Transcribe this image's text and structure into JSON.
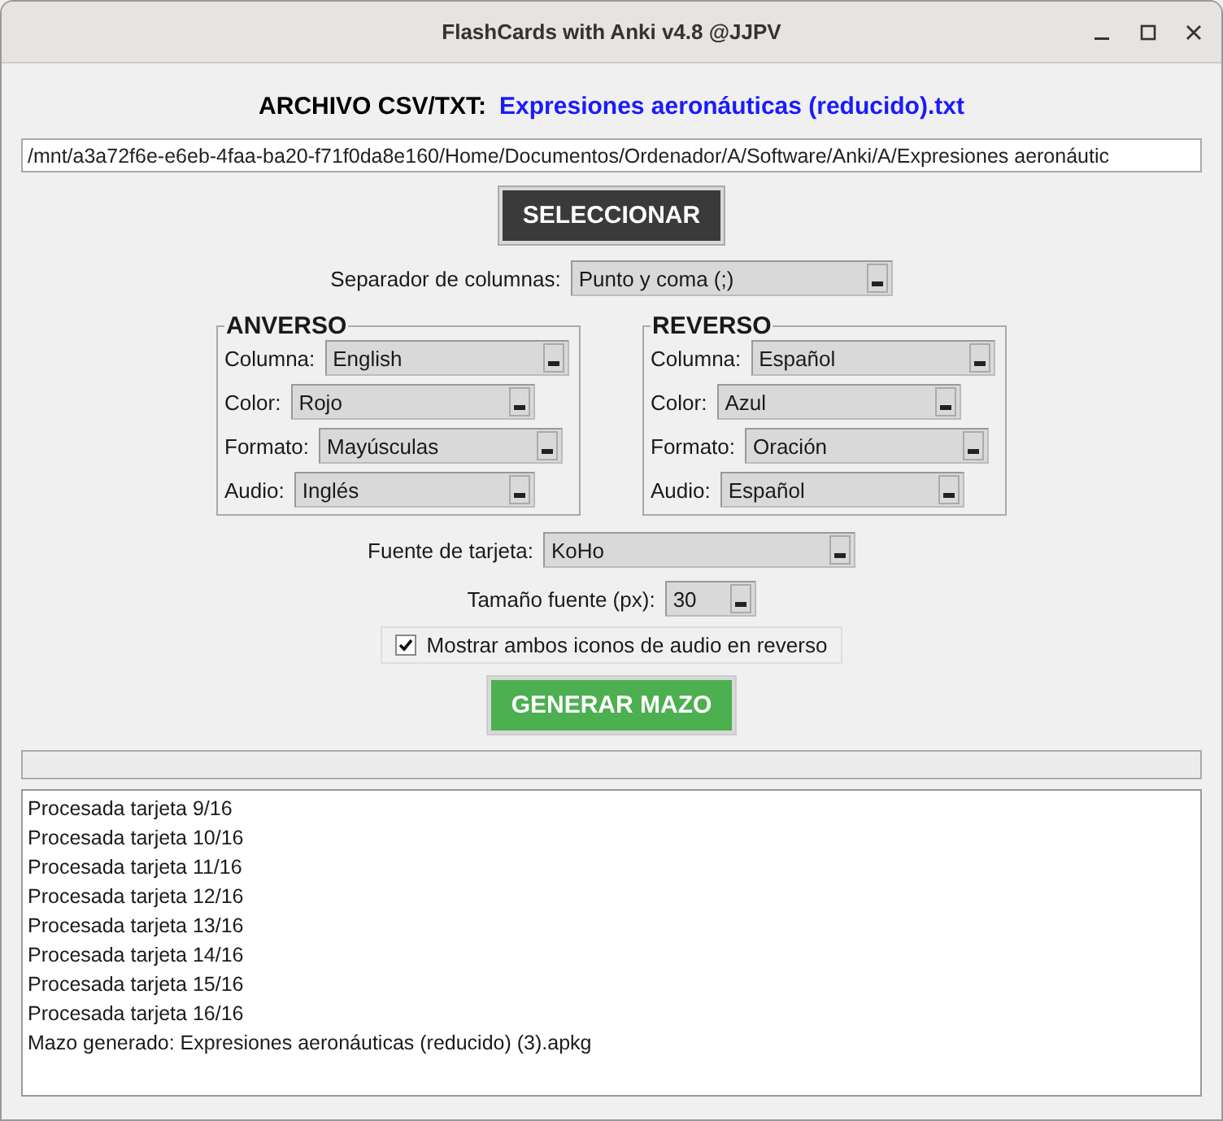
{
  "window": {
    "title": "FlashCards with Anki v4.8 @JJPV"
  },
  "file": {
    "label": "ARCHIVO CSV/TXT:",
    "name": "Expresiones aeronáuticas (reducido).txt",
    "path": "/mnt/a3a72f6e-e6eb-4faa-ba20-f71f0da8e160/Home/Documentos/Ordenador/A/Software/Anki/A/Expresiones aeronáutic"
  },
  "select_button": "SELECCIONAR",
  "separator": {
    "label": "Separador de columnas:",
    "value": "Punto y coma (;)"
  },
  "groups": [
    {
      "title": "ANVERSO",
      "fields": [
        {
          "label": "Columna:",
          "value": "English"
        },
        {
          "label": "Color:",
          "value": "Rojo"
        },
        {
          "label": "Formato:",
          "value": "Mayúsculas"
        },
        {
          "label": "Audio:",
          "value": "Inglés"
        }
      ]
    },
    {
      "title": "REVERSO",
      "fields": [
        {
          "label": "Columna:",
          "value": "Español"
        },
        {
          "label": "Color:",
          "value": "Azul"
        },
        {
          "label": "Formato:",
          "value": "Oración"
        },
        {
          "label": "Audio:",
          "value": "Español"
        }
      ]
    }
  ],
  "card_font": {
    "label": "Fuente de tarjeta:",
    "value": "KoHo"
  },
  "font_size": {
    "label": "Tamaño fuente (px):",
    "value": "30"
  },
  "both_audio": {
    "label": "Mostrar ambos iconos de audio en reverso",
    "checked": true
  },
  "generate_button": "GENERAR MAZO",
  "progress": {
    "level": 0
  },
  "log": [
    "Procesada tarjeta 9/16",
    "Procesada tarjeta 10/16",
    "Procesada tarjeta 11/16",
    "Procesada tarjeta 12/16",
    "Procesada tarjeta 13/16",
    "Procesada tarjeta 14/16",
    "Procesada tarjeta 15/16",
    "Procesada tarjeta 16/16",
    "Mazo generado: Expresiones aeronáuticas (reducido) (3).apkg"
  ]
}
